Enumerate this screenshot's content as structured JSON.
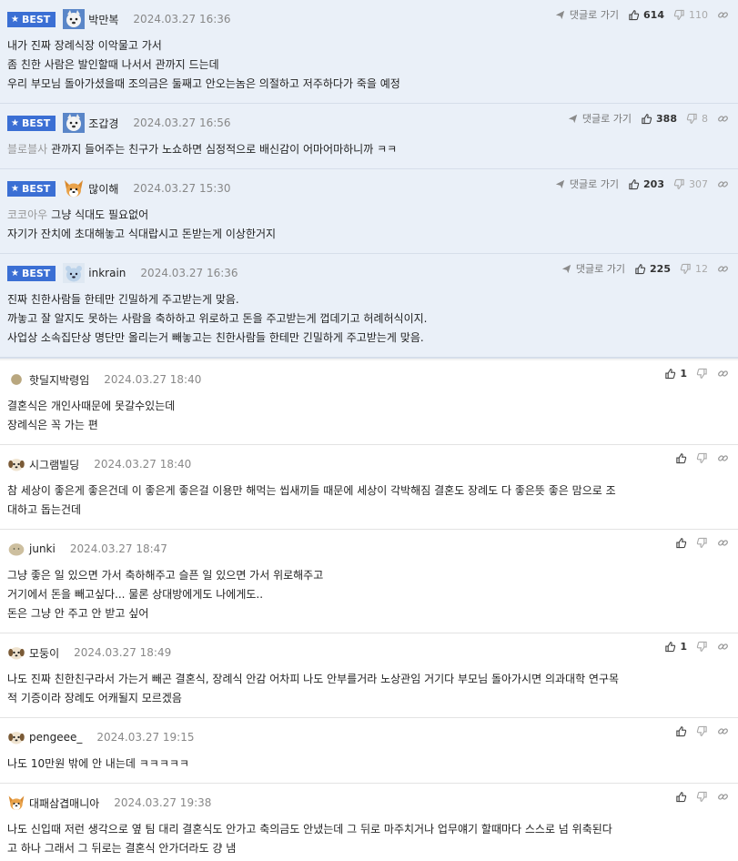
{
  "labels": {
    "best": "BEST",
    "reply": "댓글로 가기"
  },
  "best": [
    {
      "avatar": "snow-dog-icon",
      "nick": "박만복",
      "date": "2024.03.27 16:36",
      "up": "614",
      "down": "110",
      "prefix": "",
      "lines": [
        "내가 진짜 장례식장 이악물고 가서",
        "좀 친한 사람은 발인할때 나서서 관까지 드는데",
        "우리 부모님 돌아가셨을때 조의금은 둘째고 안오는놈은 의절하고 저주하다가 죽을 예정"
      ]
    },
    {
      "avatar": "snow-dog-icon",
      "nick": "조갑경",
      "date": "2024.03.27 16:56",
      "up": "388",
      "down": "8",
      "prefix": "블로블사",
      "lines": [
        "관까지 들어주는 친구가 노쇼하면 심정적으로 배신감이 어마어마하니까 ㅋㅋ"
      ]
    },
    {
      "avatar": "corgi-icon",
      "nick": "많이해",
      "date": "2024.03.27 15:30",
      "up": "203",
      "down": "307",
      "prefix": "코코아우",
      "lines": [
        "그냥 식대도 필요없어",
        "자기가 잔치에 초대해놓고 식대랍시고 돈받는게 이상한거지"
      ]
    },
    {
      "avatar": "bear-icon",
      "nick": "inkrain",
      "date": "2024.03.27 16:36",
      "up": "225",
      "down": "12",
      "prefix": "",
      "lines": [
        "진짜 친한사람들 한테만 긴밀하게 주고받는게 맞음.",
        "까놓고 잘 알지도 못하는 사람을 축하하고 위로하고 돈을 주고받는게 껍데기고 허례허식이지.",
        "사업상 소속집단상 명단만 올리는거 빼놓고는 친한사람들 한테만 긴밀하게 주고받는게 맞음."
      ]
    }
  ],
  "comments": [
    {
      "avatar": "dot-icon",
      "nick": "핫딜지박령임",
      "date": "2024.03.27 18:40",
      "up": "1",
      "lines": [
        "결혼식은 개인사때문에 못갈수있는데",
        "장례식은 꼭 가는 편"
      ]
    },
    {
      "avatar": "puppy-icon",
      "nick": "시그램빌딩",
      "date": "2024.03.27 18:40",
      "up": "",
      "lines": [
        "참 세상이 좋은게 좋은건데 이 좋은게 좋은걸 이용만 해먹는 씹새끼들 때문에 세상이 각박해짐 결혼도 장례도 다 좋은뜻 좋은 맘으로 조",
        "대하고 돕는건데"
      ]
    },
    {
      "avatar": "potato-icon",
      "nick": "junki",
      "date": "2024.03.27 18:47",
      "up": "",
      "lines": [
        "그냥 좋은 일 있으면 가서 축하해주고 슬픈 일 있으면 가서 위로해주고",
        "거기에서 돈을 빼고싶다... 물론 상대방에게도 나에게도..",
        "돈은 그냥 안 주고 안 받고 싶어"
      ]
    },
    {
      "avatar": "puppy-icon",
      "nick": "모둥이",
      "date": "2024.03.27 18:49",
      "up": "1",
      "lines": [
        "나도 진짜 친한친구라서 가는거 빼곤 결혼식, 장례식 안감 어차피 나도 안부를거라 노상관임 거기다 부모님 돌아가시면 의과대학 연구목",
        "적 기증이라 장례도 어캐될지 모르겠음"
      ]
    },
    {
      "avatar": "puppy-icon",
      "nick": "pengeee_",
      "date": "2024.03.27 19:15",
      "up": "",
      "lines": [
        "나도 10만원 밖에 안 내는데 ㅋㅋㅋㅋㅋ"
      ]
    },
    {
      "avatar": "corgi-icon",
      "nick": "대패삼겹매니아",
      "date": "2024.03.27 19:38",
      "up": "",
      "lines": [
        "나도 신입때 저런 생각으로 옆 팀 대리 결혼식도 안가고 축의금도 안냈는데 그 뒤로 마주치거나 업무얘기 할때마다 스스로 넘 위축된다",
        "고 하나 그래서 그 뒤로는 결혼식 안가더라도 걍 냄"
      ]
    }
  ],
  "colors": {
    "best_bg": "#eaf0f8",
    "badge": "#3b6fd4"
  }
}
